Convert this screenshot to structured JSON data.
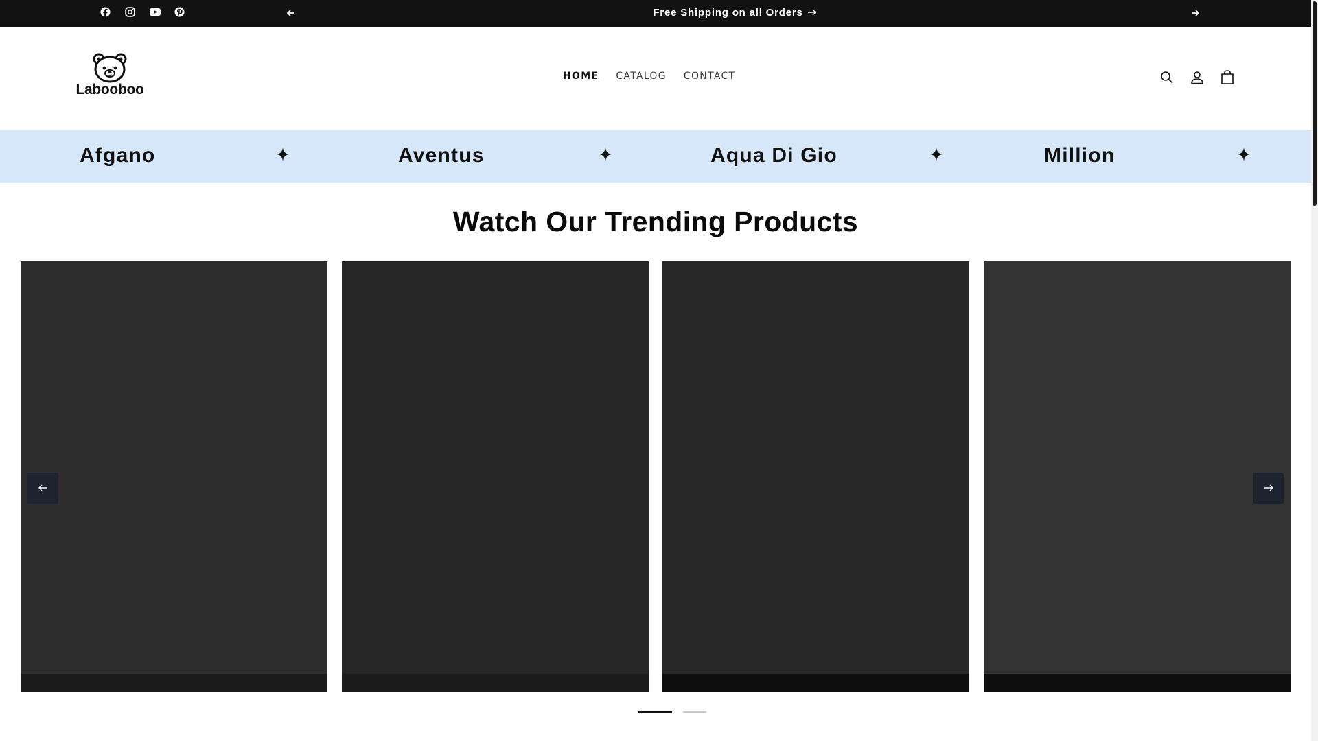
{
  "announcement": {
    "message": "Free Shipping on all Orders",
    "social_icons": [
      "facebook-icon",
      "instagram-icon",
      "youtube-icon",
      "pinterest-icon"
    ]
  },
  "header": {
    "logo_text": "Labooboo",
    "nav": [
      {
        "label": "HOME",
        "active": true
      },
      {
        "label": "CATALOG",
        "active": false
      },
      {
        "label": "CONTACT",
        "active": false
      }
    ],
    "icons": [
      "search-icon",
      "account-icon",
      "cart-icon"
    ]
  },
  "marquee": {
    "background": "#d7e7fa",
    "items": [
      "Afgano",
      "Aventus",
      "Aqua Di Gio",
      "Million"
    ]
  },
  "trending": {
    "title": "Watch Our Trending Products",
    "card_colors": [
      "#2d2d2d",
      "#262626",
      "#282828",
      "#333333"
    ],
    "slide_count": 2,
    "active_slide": 1
  },
  "colors": {
    "announcement_bg": "#121212",
    "text": "#121212",
    "slider_button": "#1e2330"
  }
}
